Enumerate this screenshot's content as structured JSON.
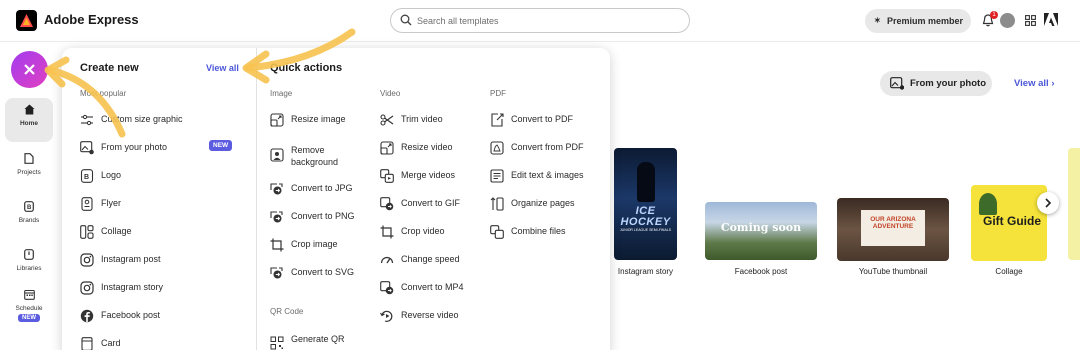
{
  "header": {
    "app_title": "Adobe Express",
    "search_placeholder": "Search all templates",
    "premium_label": "Premium member",
    "notification_count": "1"
  },
  "rail": {
    "items": [
      {
        "label": "Home",
        "icon": "home-icon",
        "active": true
      },
      {
        "label": "Projects",
        "icon": "file-icon"
      },
      {
        "label": "Brands",
        "icon": "brand-icon"
      },
      {
        "label": "Libraries",
        "icon": "library-icon"
      },
      {
        "label": "Schedule",
        "icon": "calendar-icon",
        "badge": "NEW"
      }
    ]
  },
  "panel": {
    "create_new": {
      "heading": "Create new",
      "view_all": "View all",
      "section": "Most popular",
      "items": [
        {
          "label": "Custom size graphic",
          "icon": "custom-size-icon"
        },
        {
          "label": "From your photo",
          "icon": "photo-icon",
          "badge": "NEW"
        },
        {
          "label": "Logo",
          "icon": "logo-icon"
        },
        {
          "label": "Flyer",
          "icon": "flyer-icon"
        },
        {
          "label": "Collage",
          "icon": "collage-icon"
        },
        {
          "label": "Instagram post",
          "icon": "instagram-icon"
        },
        {
          "label": "Instagram story",
          "icon": "instagram-icon"
        },
        {
          "label": "Facebook post",
          "icon": "facebook-icon"
        },
        {
          "label": "Card",
          "icon": "card-icon"
        }
      ]
    },
    "quick_actions": {
      "heading": "Quick actions",
      "image": {
        "label": "Image",
        "items": [
          {
            "label": "Resize image",
            "icon": "resize-icon"
          },
          {
            "label": "Remove background",
            "icon": "remove-bg-icon"
          },
          {
            "label": "Convert to JPG",
            "icon": "convert-icon"
          },
          {
            "label": "Convert to PNG",
            "icon": "convert-icon"
          },
          {
            "label": "Crop image",
            "icon": "crop-icon"
          },
          {
            "label": "Convert to SVG",
            "icon": "convert-icon"
          }
        ]
      },
      "qr": {
        "label": "QR Code",
        "items": [
          {
            "label": "Generate QR",
            "icon": "qr-icon"
          }
        ]
      },
      "video": {
        "label": "Video",
        "items": [
          {
            "label": "Trim video",
            "icon": "trim-icon"
          },
          {
            "label": "Resize video",
            "icon": "resize-icon"
          },
          {
            "label": "Merge videos",
            "icon": "merge-icon"
          },
          {
            "label": "Convert to GIF",
            "icon": "convert-icon"
          },
          {
            "label": "Crop video",
            "icon": "crop-icon"
          },
          {
            "label": "Change speed",
            "icon": "speed-icon"
          },
          {
            "label": "Convert to MP4",
            "icon": "convert-icon"
          },
          {
            "label": "Reverse video",
            "icon": "reverse-icon"
          }
        ]
      },
      "pdf": {
        "label": "PDF",
        "items": [
          {
            "label": "Convert to PDF",
            "icon": "pdf-icon"
          },
          {
            "label": "Convert from PDF",
            "icon": "pdf-icon"
          },
          {
            "label": "Edit text & images",
            "icon": "edit-icon"
          },
          {
            "label": "Organize pages",
            "icon": "pages-icon"
          },
          {
            "label": "Combine files",
            "icon": "combine-icon"
          }
        ]
      }
    }
  },
  "background": {
    "from_photo_button": "From your photo",
    "view_all": "View all",
    "templates": [
      {
        "label": "Instagram story",
        "text": "ICE HOCKEY",
        "subtext": "JUNIOR LEAGUE SEMI-FINALS"
      },
      {
        "label": "Facebook post",
        "text": "Coming soon"
      },
      {
        "label": "YouTube thumbnail",
        "text": "OUR ARIZONA ADVENTURE"
      },
      {
        "label": "Collage",
        "text": "Gift Guide"
      }
    ]
  },
  "colors": {
    "accent": "#4b57d8",
    "new_badge": "#5c5ce0",
    "fab_gradient": [
      "#a33cf0",
      "#e040c0"
    ],
    "annotation_arrow": "#f7c24f"
  }
}
